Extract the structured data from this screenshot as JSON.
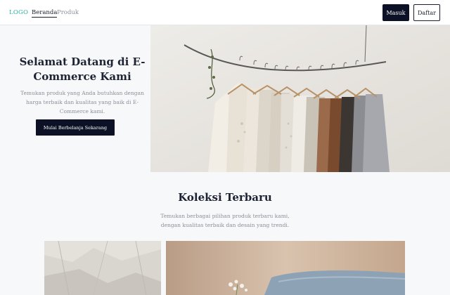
{
  "nav": {
    "logo": "LOGO",
    "links": [
      {
        "label": "Beranda",
        "active": true
      },
      {
        "label": "Produk",
        "active": false
      }
    ],
    "login_label": "Masuk",
    "register_label": "Daftar"
  },
  "hero": {
    "title": "Selamat Datang di E-Commerce Kami",
    "subtitle": "Temukan produk yang Anda butuhkan dengan harga terbaik dan kualitas yang baik di E-Commerce kami.",
    "cta_label": "Mulai Berbelanja Sekarang",
    "image": "clothes-rack-photo"
  },
  "collection": {
    "title": "Koleksi Terbaru",
    "subtitle": "Temukan berbagai pilihan produk terbaru kami, dengan kualitas terbaik dan desain yang trendi.",
    "images": [
      "crumpled-paper-photo",
      "denim-flowers-photo"
    ]
  },
  "colors": {
    "primary": "#0d1126",
    "logo": "#2bb3a0",
    "muted_text": "#8a8f99",
    "background": "#f7f8fa"
  }
}
